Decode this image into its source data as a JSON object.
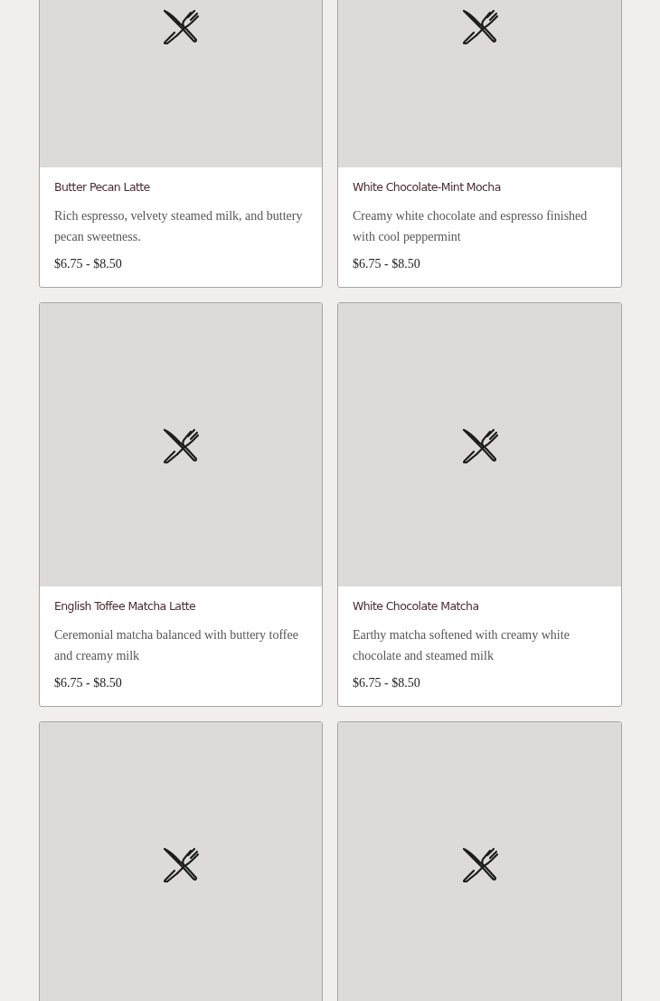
{
  "menu_items": [
    {
      "kind": "placeholder",
      "name": "Butter Pecan Latte",
      "description": "Rich espresso, velvety steamed milk, and buttery pecan sweetness.",
      "price": "$6.75 - $8.50"
    },
    {
      "kind": "placeholder",
      "name": "White Chocolate-Mint Mocha",
      "description": "Creamy white chocolate and espresso finished with cool peppermint",
      "price": "$6.75 - $8.50"
    },
    {
      "kind": "placeholder",
      "name": "English Toffee Matcha Latte",
      "description": "Ceremonial matcha balanced with buttery toffee and creamy milk",
      "price": "$6.75 - $8.50"
    },
    {
      "kind": "placeholder",
      "name": "White Chocolate Matcha",
      "description": "Earthy matcha softened with creamy white chocolate and steamed milk",
      "price": "$6.75 - $8.50"
    },
    {
      "kind": "placeholder"
    },
    {
      "kind": "placeholder"
    }
  ]
}
